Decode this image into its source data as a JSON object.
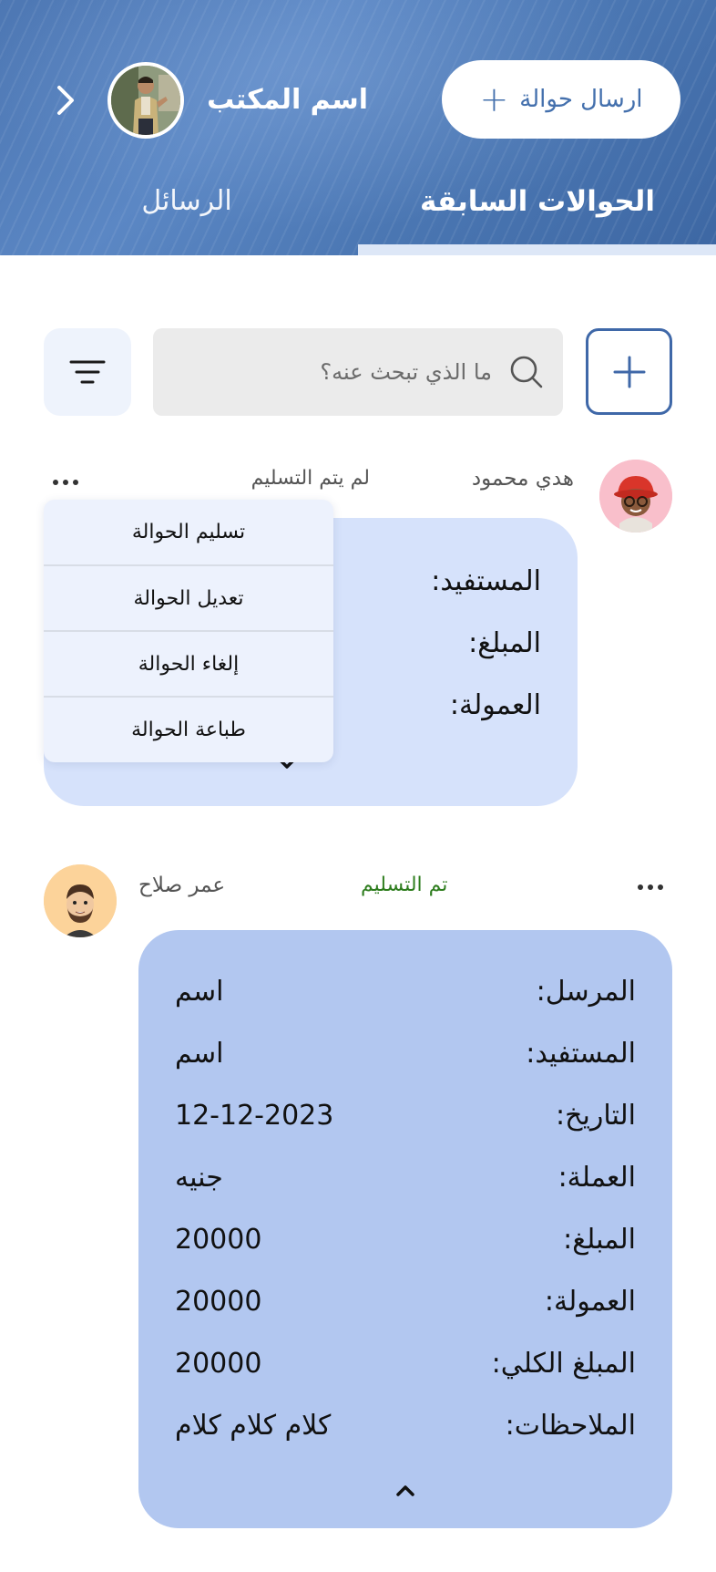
{
  "header": {
    "office_name": "اسم المكتب",
    "send_button_label": "ارسال حوالة",
    "tabs": [
      {
        "label": "الحوالات السابقة",
        "active": true
      },
      {
        "label": "الرسائل",
        "active": false
      }
    ]
  },
  "search": {
    "placeholder": "ما الذي تبحث عنه؟"
  },
  "transfers": [
    {
      "name": "هدي محمود",
      "status": "لم يتم التسليم",
      "fields": [
        {
          "label": "المستفيد:"
        },
        {
          "label": "المبلغ:"
        },
        {
          "label": "العمولة:"
        }
      ],
      "menu": [
        {
          "label": "تسليم الحوالة"
        },
        {
          "label": "تعديل الحوالة"
        },
        {
          "label": "إلغاء الحوالة"
        },
        {
          "label": "طباعة الحوالة"
        }
      ]
    },
    {
      "name": "عمر صلاح",
      "status": "تم التسليم",
      "fields": [
        {
          "label": "المرسل:",
          "value": "اسم"
        },
        {
          "label": "المستفيد:",
          "value": "اسم"
        },
        {
          "label": "التاريخ:",
          "value": "12-12-2023"
        },
        {
          "label": "العملة:",
          "value": "جنيه"
        },
        {
          "label": "المبلغ:",
          "value": "20000"
        },
        {
          "label": "العمولة:",
          "value": "20000"
        },
        {
          "label": "المبلغ الكلي:",
          "value": "20000"
        },
        {
          "label": "الملاحظات:",
          "value": "كلام كلام كلام"
        }
      ]
    }
  ],
  "colors": {
    "primary": "#4470ad",
    "header_bg": "#4d77b3",
    "card_collapsed": "#d6e2fb",
    "card_expanded": "#b2c7f0",
    "status_pending": "#555555",
    "status_delivered": "#2e7d1e",
    "menu_bg": "#edf2fd"
  },
  "icons": [
    "chevron-right-icon",
    "plus-icon",
    "filter-icon",
    "search-icon",
    "more-icon",
    "chevron-down-icon",
    "chevron-up-icon"
  ]
}
